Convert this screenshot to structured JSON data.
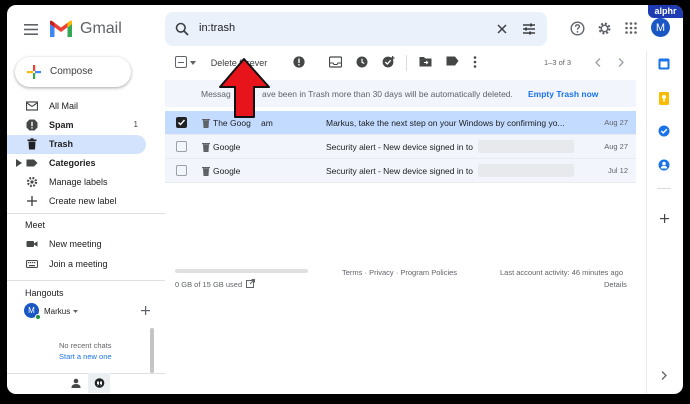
{
  "header": {
    "app_name": "Gmail",
    "search_value": "in:trash",
    "account_initial": "M",
    "watermark": "alphr"
  },
  "sidebar": {
    "compose_label": "Compose",
    "items": [
      {
        "label": "All Mail",
        "icon": "all-mail-icon"
      },
      {
        "label": "Spam",
        "icon": "spam-icon",
        "count": "1"
      },
      {
        "label": "Trash",
        "icon": "trash-icon"
      },
      {
        "label": "Categories",
        "icon": "label-icon"
      },
      {
        "label": "Manage labels",
        "icon": "gear-icon"
      },
      {
        "label": "Create new label",
        "icon": "plus-icon"
      }
    ],
    "meet": {
      "title": "Meet",
      "new_meeting": "New meeting",
      "join_meeting": "Join a meeting"
    },
    "hangouts": {
      "title": "Hangouts",
      "user_name": "Markus",
      "user_initial": "M",
      "no_recent": "No recent chats",
      "start_new": "Start a new one"
    }
  },
  "toolbar": {
    "delete_forever": "Delete forever",
    "pagination": "1–3 of 3"
  },
  "banner": {
    "message_start": "Messag",
    "message_end": "ave been in Trash more than 30 days will be automatically deleted.",
    "empty_trash": "Empty Trash now"
  },
  "emails": [
    {
      "sender": "The Goog",
      "sender_tail": "am",
      "subject": "Markus, take the next step on your Windows by confirming yo...",
      "date": "Aug 27",
      "selected": true
    },
    {
      "sender": "Google",
      "subject": "Security alert - New device signed in to",
      "date": "Aug 27",
      "selected": false
    },
    {
      "sender": "Google",
      "subject": "Security alert - New device signed in to",
      "date": "Jul 12",
      "selected": false
    }
  ],
  "footer": {
    "storage": "0 GB of 15 GB used",
    "terms": "Terms",
    "sep1": " · ",
    "privacy": "Privacy",
    "sep2": " · ",
    "policies": "Program Policies",
    "last_activity": "Last account activity: 46 minutes ago",
    "details": "Details"
  },
  "colors": {
    "accent_blue": "#1a73e8",
    "arrow_red": "#e8141b",
    "selected_row": "#c2dbff",
    "active_nav": "#d3e3fd"
  }
}
